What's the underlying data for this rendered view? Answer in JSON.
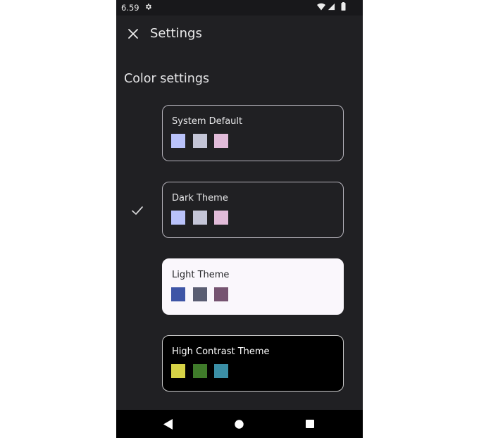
{
  "status_bar": {
    "time": "6.59",
    "icons": [
      "settings-gear-icon",
      "wifi-icon",
      "signal-icon",
      "battery-icon"
    ]
  },
  "app_bar": {
    "close_icon": "close-icon",
    "title": "Settings"
  },
  "section": {
    "title": "Color settings"
  },
  "themes": [
    {
      "label": "System Default",
      "selected": false,
      "swatches": [
        "#b9c2fa",
        "#c4c5d7",
        "#e1bbd9"
      ]
    },
    {
      "label": "Dark Theme",
      "selected": true,
      "swatches": [
        "#b9c2fa",
        "#c4c5d7",
        "#e1bbd9"
      ]
    },
    {
      "label": "Light Theme",
      "selected": false,
      "swatches": [
        "#3e55a6",
        "#5a5d72",
        "#765471"
      ]
    },
    {
      "label": "High Contrast Theme",
      "selected": false,
      "swatches": [
        "#d6d246",
        "#3f7b2a",
        "#3b8fa6"
      ]
    }
  ],
  "nav_bar": {
    "icons": [
      "back-icon",
      "home-icon",
      "recents-icon"
    ]
  },
  "colors": {
    "background": "#202023",
    "status_bar": "#18181b",
    "nav_bar": "#000000",
    "card_border": "#b5b3bb",
    "light_card": "#faf7fc",
    "contrast_card": "#000000"
  }
}
